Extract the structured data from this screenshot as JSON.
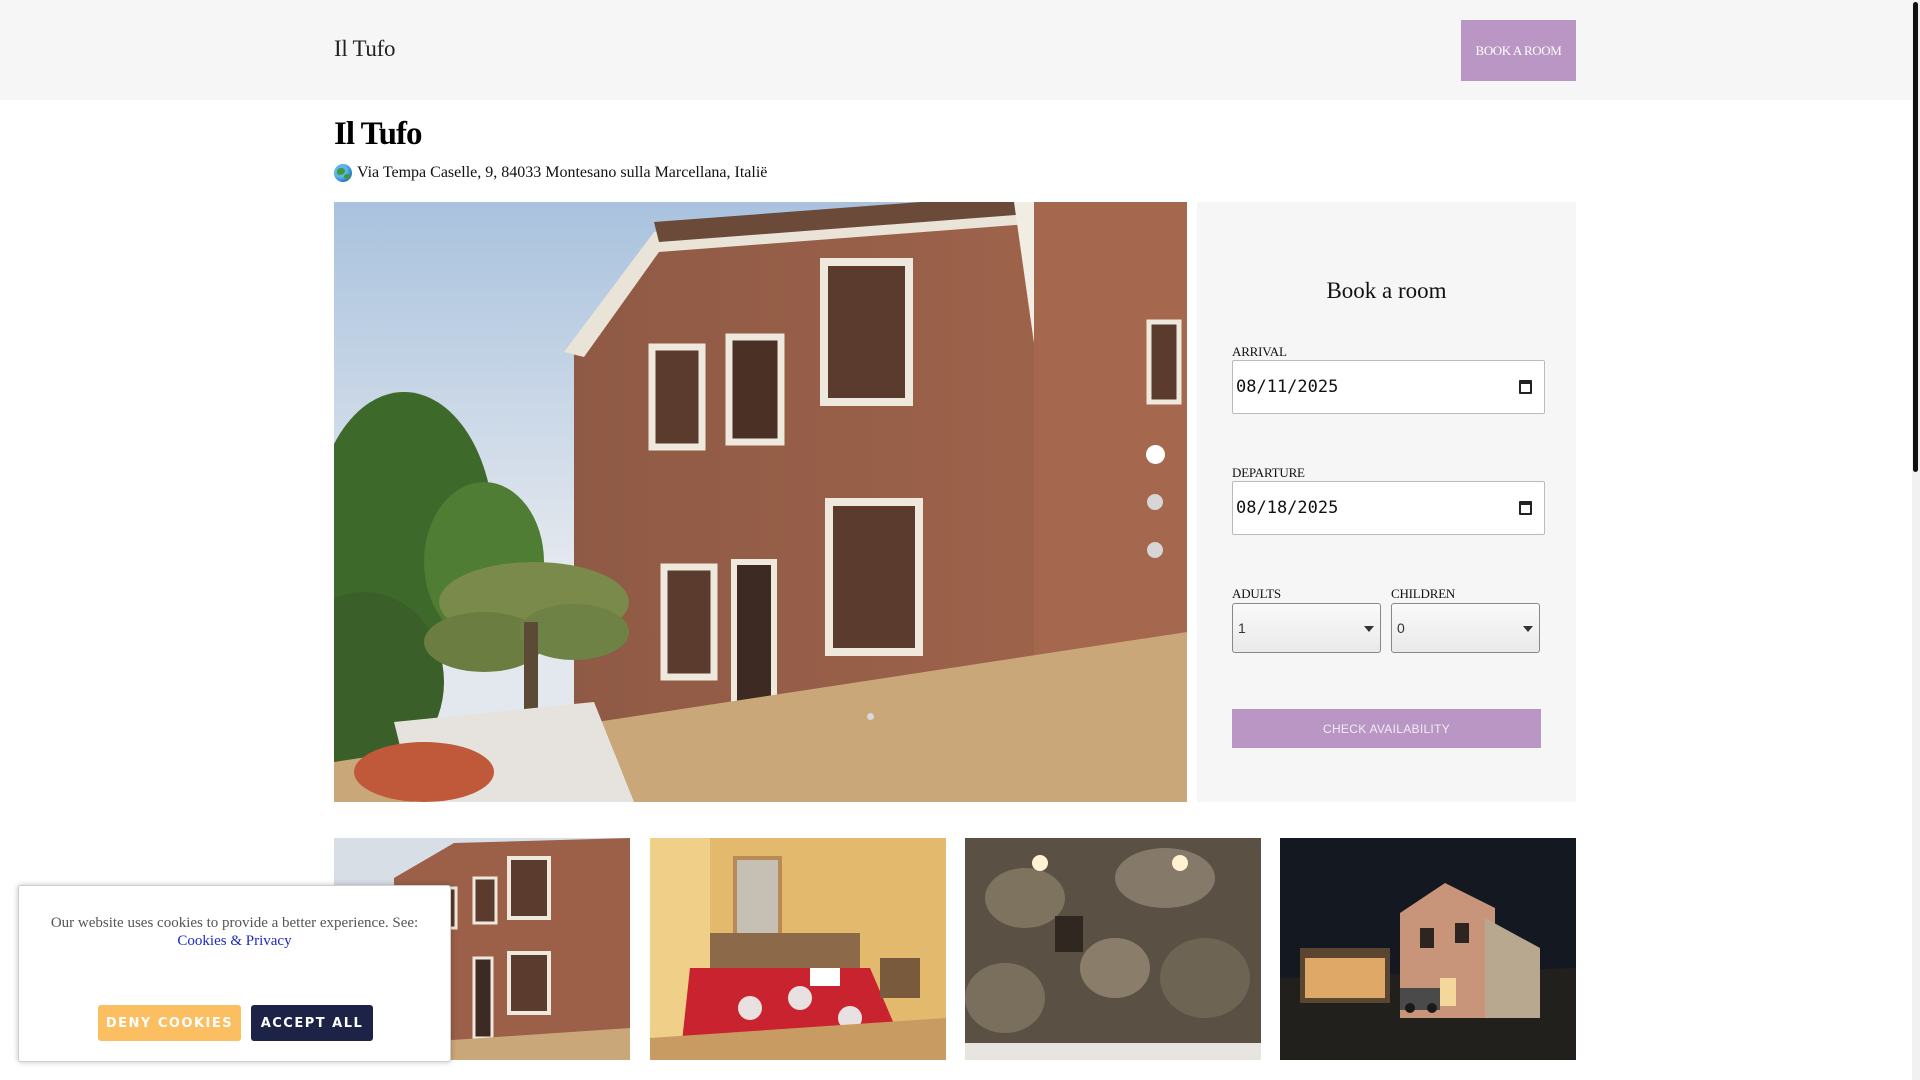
{
  "header": {
    "brand": "Il Tufo",
    "book_button": "BOOK A ROOM"
  },
  "property": {
    "title": "Il Tufo",
    "address_icon": "globe-icon",
    "address": "Via Tempa Caselle, 9, 84033 Montesano sulla Marcellana, Italië"
  },
  "carousel": {
    "slide_count": 3,
    "active_slide": 1
  },
  "booking": {
    "title": "Book a room",
    "arrival_label": "ARRIVAL",
    "arrival_value": "08/11/2025",
    "departure_label": "DEPARTURE",
    "departure_value": "08/18/2025",
    "adults_label": "ADULTS",
    "adults_value": "1",
    "children_label": "CHILDREN",
    "children_value": "0",
    "check_button": "CHECK AVAILABILITY"
  },
  "colors": {
    "accent": "#b996c4",
    "deny": "#fbbf62",
    "accept": "#1d2347",
    "link": "#1c2bc5"
  },
  "cookie": {
    "text": "Our website uses cookies to provide a better experience. See:",
    "link": "Cookies & Privacy",
    "deny": "DENY COOKIES",
    "accept": "ACCEPT ALL"
  }
}
